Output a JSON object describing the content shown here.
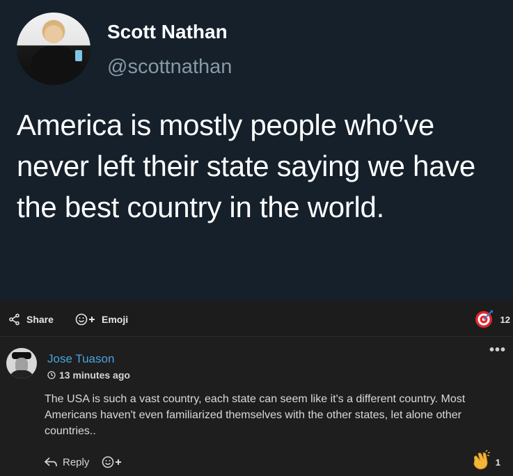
{
  "tweet": {
    "name": "Scott Nathan",
    "handle": "@scottnathan",
    "text": "America is mostly people who’ve never left their state saying we have the best country in the world."
  },
  "actions": {
    "share_label": "Share",
    "emoji_label": "Emoji",
    "reaction_icon": "target-emoji",
    "reaction_count": "12"
  },
  "comment": {
    "author": "Jose Tuason",
    "time": "13 minutes ago",
    "body": "The USA is such a vast country, each state can seem like it's a different country. Most Americans haven't even familiarized themselves with the other states, let alone other countries..",
    "reply_label": "Reply",
    "reaction_icon": "clapping-hands-emoji",
    "reaction_count": "1",
    "more": "•••"
  }
}
